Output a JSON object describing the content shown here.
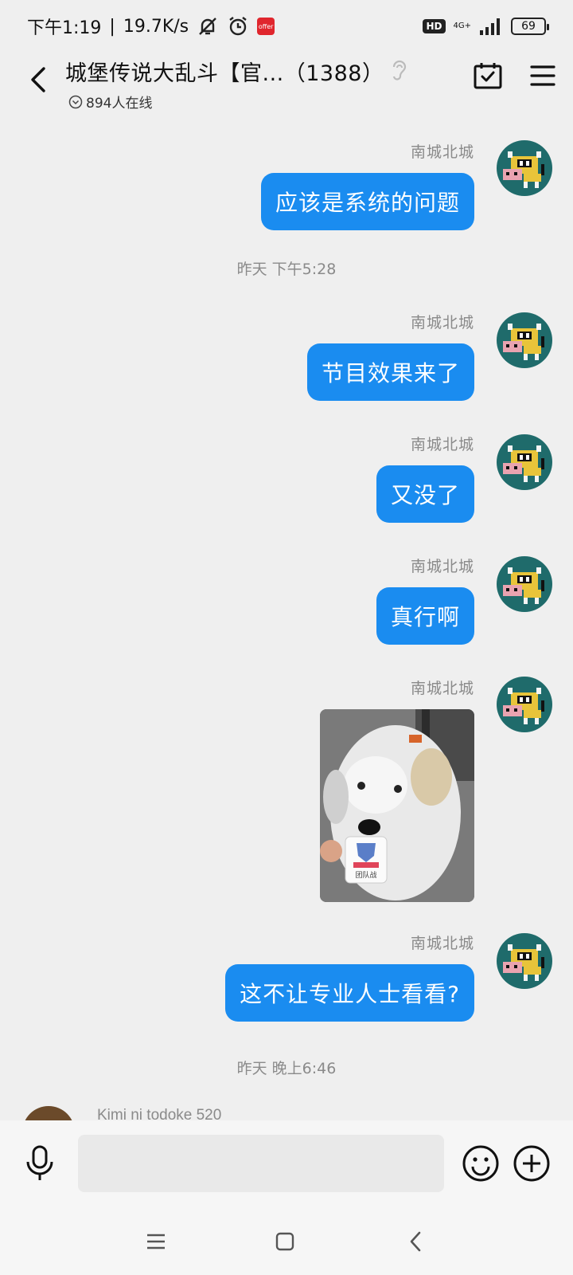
{
  "status_bar": {
    "time": "下午1:19",
    "speed": "19.7K/s",
    "hd": "HD",
    "network": "4G+",
    "battery": "69",
    "offer_badge": "offer"
  },
  "header": {
    "title": "城堡传说大乱斗【官...（1388）",
    "online": "894人在线"
  },
  "messages": [
    {
      "sender": "南城北城",
      "text": "应该是系统的问题"
    },
    {
      "sender": "南城北城",
      "text": "节目效果来了"
    },
    {
      "sender": "南城北城",
      "text": "又没了"
    },
    {
      "sender": "南城北城",
      "text": "真行啊"
    },
    {
      "sender": "南城北城",
      "image_badge": "团队战"
    },
    {
      "sender": "南城北城",
      "text": "这不让专业人士看看?"
    }
  ],
  "timestamps": [
    "昨天  下午5:28",
    "昨天  晚上6:46"
  ],
  "peek": {
    "sender": "Kimi ni todoke 520"
  },
  "input": {
    "placeholder": ""
  },
  "colors": {
    "bubble": "#1a8cf0",
    "background": "#efefef"
  }
}
